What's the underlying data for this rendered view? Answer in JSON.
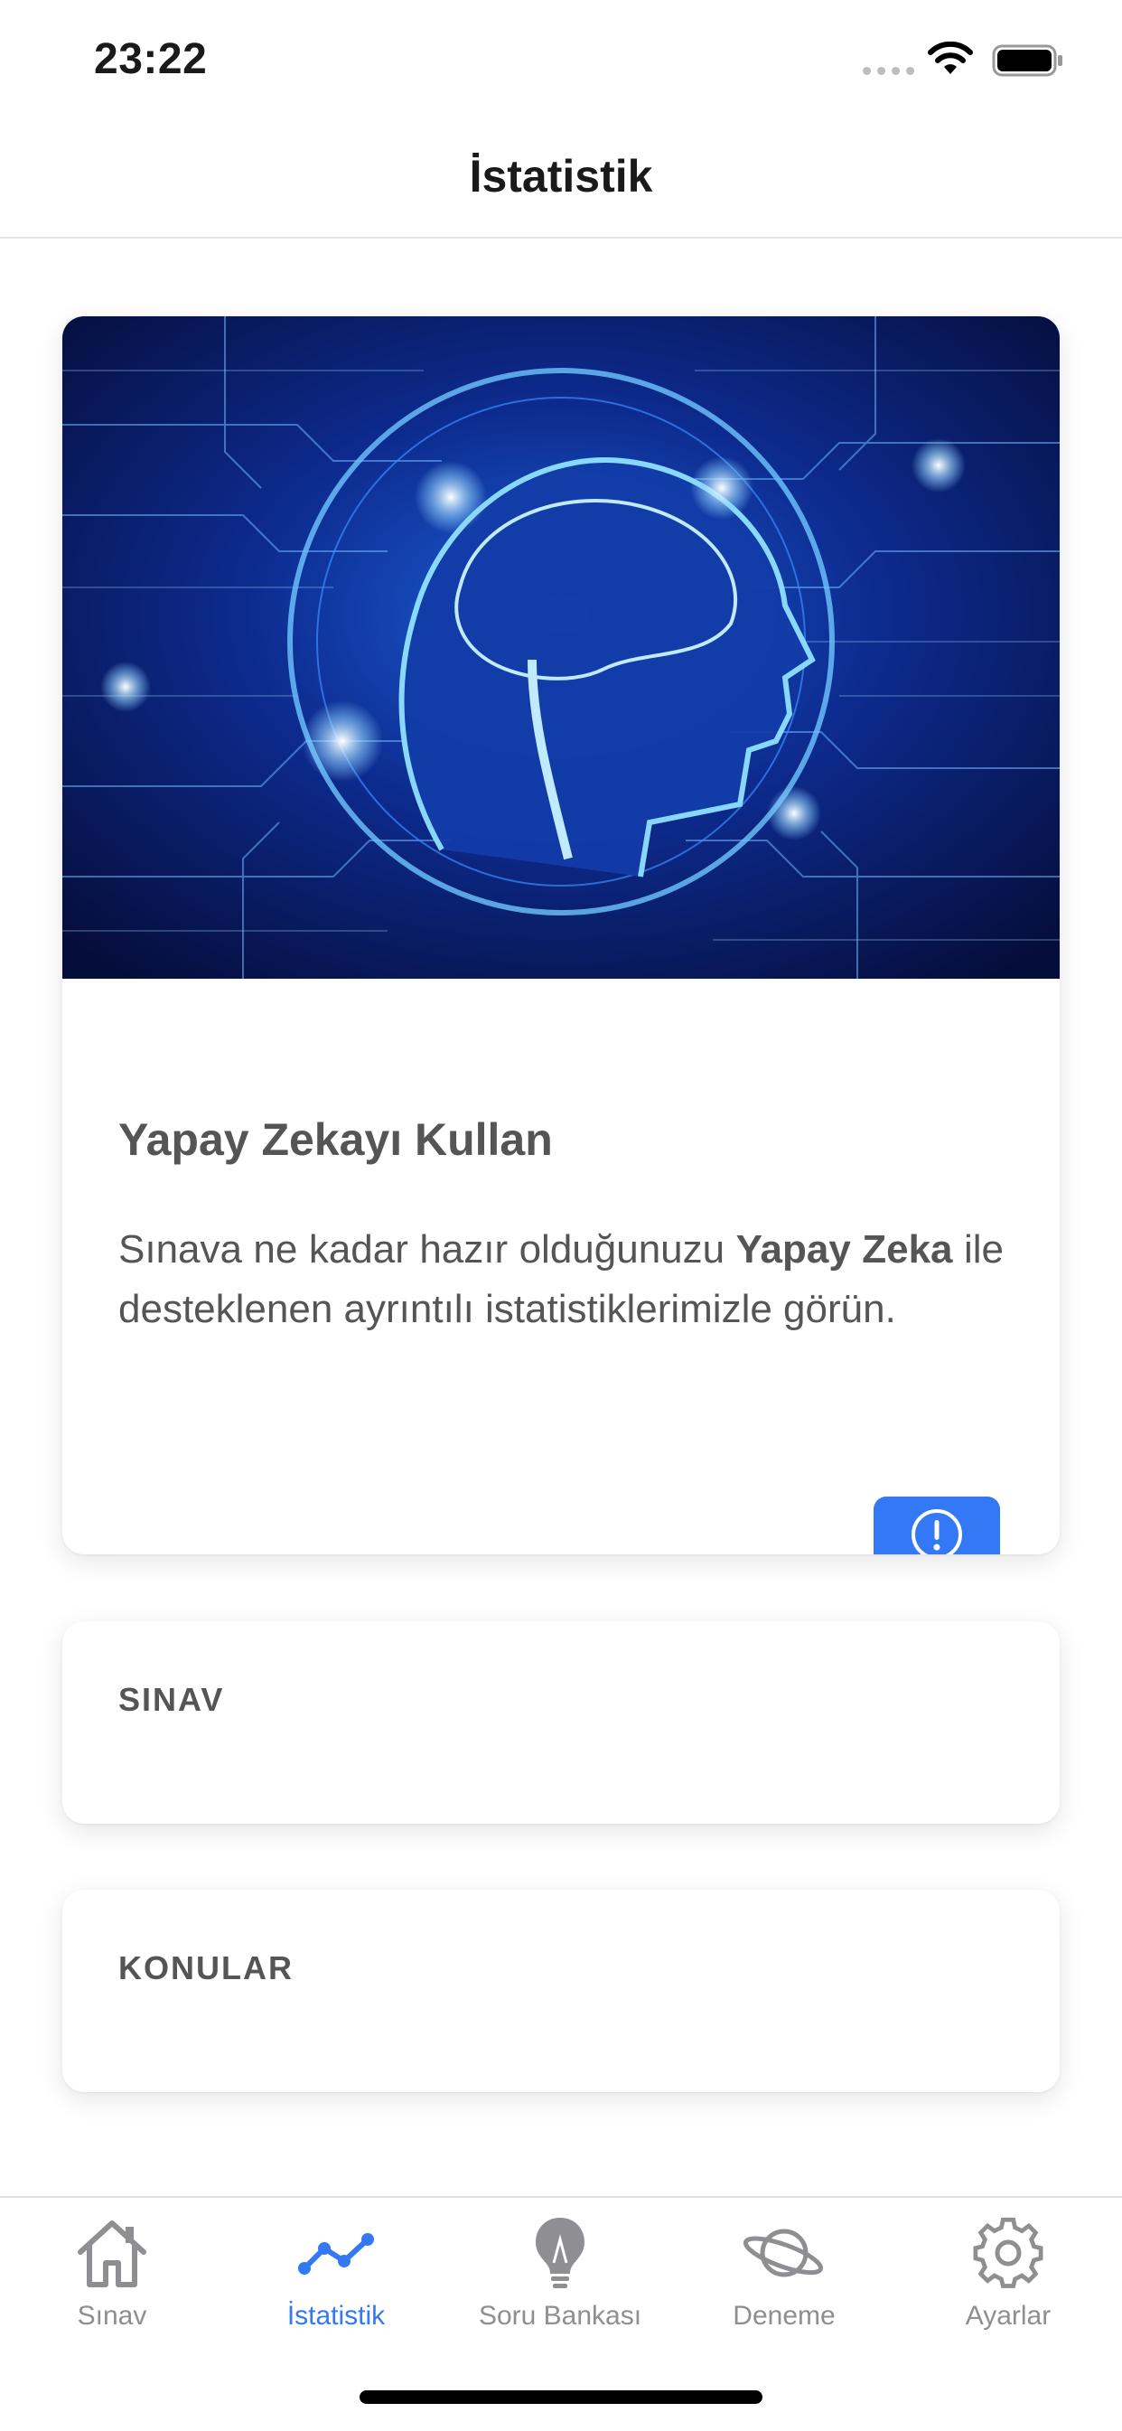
{
  "status_bar": {
    "time": "23:22"
  },
  "nav": {
    "title": "İstatistik"
  },
  "ai_card": {
    "image_description_icon": "ai-brain-image",
    "title": "Yapay Zekayı Kullan",
    "desc_part1": "Sınava ne kadar hazır olduğunuzu ",
    "desc_bold": "Yapay Zeka",
    "desc_part2": " ile desteklenen ayrıntılı istatistiklerimizle görün.",
    "info_icon": "exclamation-circle-icon"
  },
  "sections": {
    "sinav": "SINAV",
    "konular": "KONULAR"
  },
  "tabs": [
    {
      "label": "Sınav",
      "icon": "home-icon",
      "active": false
    },
    {
      "label": "İstatistik",
      "icon": "trend-icon",
      "active": true
    },
    {
      "label": "Soru Bankası",
      "icon": "lightbulb-icon",
      "active": false
    },
    {
      "label": "Deneme",
      "icon": "planet-icon",
      "active": false
    },
    {
      "label": "Ayarlar",
      "icon": "gear-icon",
      "active": false
    }
  ],
  "colors": {
    "accent": "#3478f6",
    "inactive": "#8e8e93"
  }
}
